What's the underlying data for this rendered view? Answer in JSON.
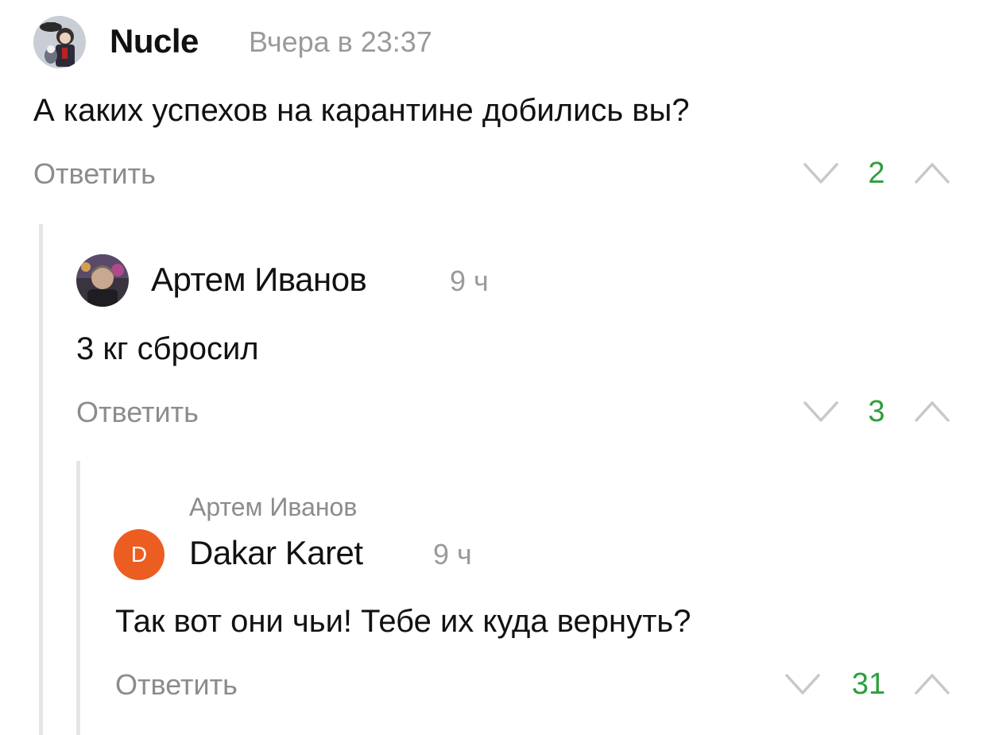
{
  "colors": {
    "score_positive": "#2e9e3e",
    "avatar_initial_bg": "#ec5d22",
    "thread_line": "#e6e6e6"
  },
  "comments": [
    {
      "author": "Nucle",
      "time": "Вчера в 23:37",
      "text": "А каких успехов на карантине добились вы?",
      "reply_label": "Ответить",
      "score": "2",
      "avatar_icon": "user-photo-avatar"
    },
    {
      "author": "Артем Иванов",
      "time": "9 ч",
      "text": "3 кг сбросил",
      "reply_label": "Ответить",
      "score": "3",
      "avatar_icon": "user-photo-avatar"
    },
    {
      "reply_to": "Артем Иванов",
      "author": "Dakar Karet",
      "avatar_initial": "D",
      "time": "9 ч",
      "text": "Так вот они чьи! Тебе их куда вернуть?",
      "reply_label": "Ответить",
      "score": "31"
    }
  ]
}
